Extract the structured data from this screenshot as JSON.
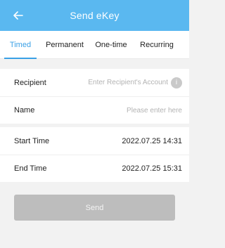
{
  "header": {
    "title": "Send eKey",
    "back_icon": "arrow-left-icon"
  },
  "tabs": [
    {
      "label": "Timed",
      "active": true
    },
    {
      "label": "Permanent",
      "active": false
    },
    {
      "label": "One-time",
      "active": false
    },
    {
      "label": "Recurring",
      "active": false
    }
  ],
  "form": {
    "recipient": {
      "label": "Recipient",
      "placeholder": "Enter Recipient's Account",
      "badge": "i"
    },
    "name": {
      "label": "Name",
      "placeholder": "Please enter here"
    },
    "start_time": {
      "label": "Start Time",
      "value": "2022.07.25 14:31"
    },
    "end_time": {
      "label": "End Time",
      "value": "2022.07.25 15:31"
    }
  },
  "send_button": {
    "label": "Send"
  },
  "colors": {
    "header": "#5ab8f0",
    "accent": "#3aa0e6",
    "button_disabled": "#bdbdbd",
    "background": "#f2f2f2"
  }
}
